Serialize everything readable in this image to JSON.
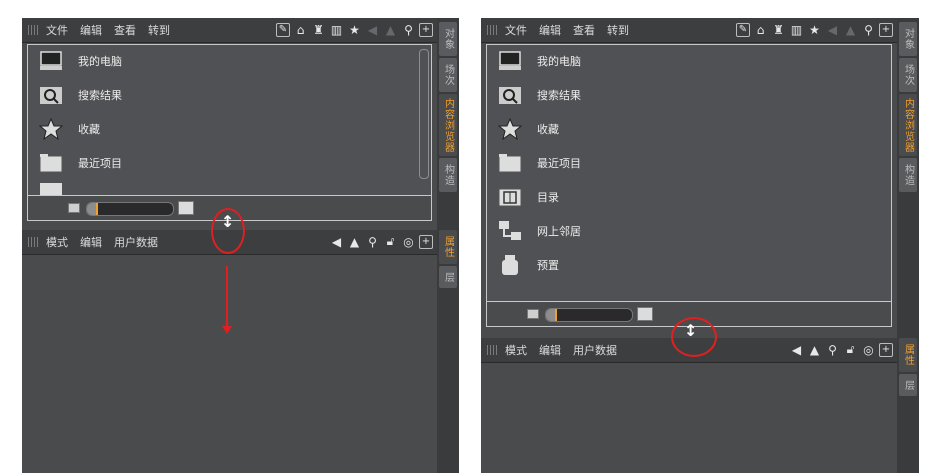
{
  "menus": {
    "file": "文件",
    "edit": "编辑",
    "view": "查看",
    "goto": "转到"
  },
  "side_tabs": {
    "objects": "对象",
    "scene": "场次",
    "content_browser": "内容浏览器",
    "build": "构造",
    "attributes": "属性",
    "layers": "层"
  },
  "browser_items": [
    {
      "label": "我的电脑",
      "icon": "computer-icon"
    },
    {
      "label": "搜索结果",
      "icon": "search-results-icon"
    },
    {
      "label": "收藏",
      "icon": "star-icon"
    },
    {
      "label": "最近项目",
      "icon": "folder-icon"
    },
    {
      "label": "目录",
      "icon": "catalog-icon"
    },
    {
      "label": "网上邻居",
      "icon": "network-icon"
    },
    {
      "label": "预置",
      "icon": "presets-icon"
    }
  ],
  "attr_menus": {
    "mode": "模式",
    "edit": "编辑",
    "user_data": "用户数据"
  },
  "resize_cursor": "↕",
  "colors": {
    "panel": "#4a4b4d",
    "accent": "#f0a030",
    "annotation": "#e02020"
  }
}
